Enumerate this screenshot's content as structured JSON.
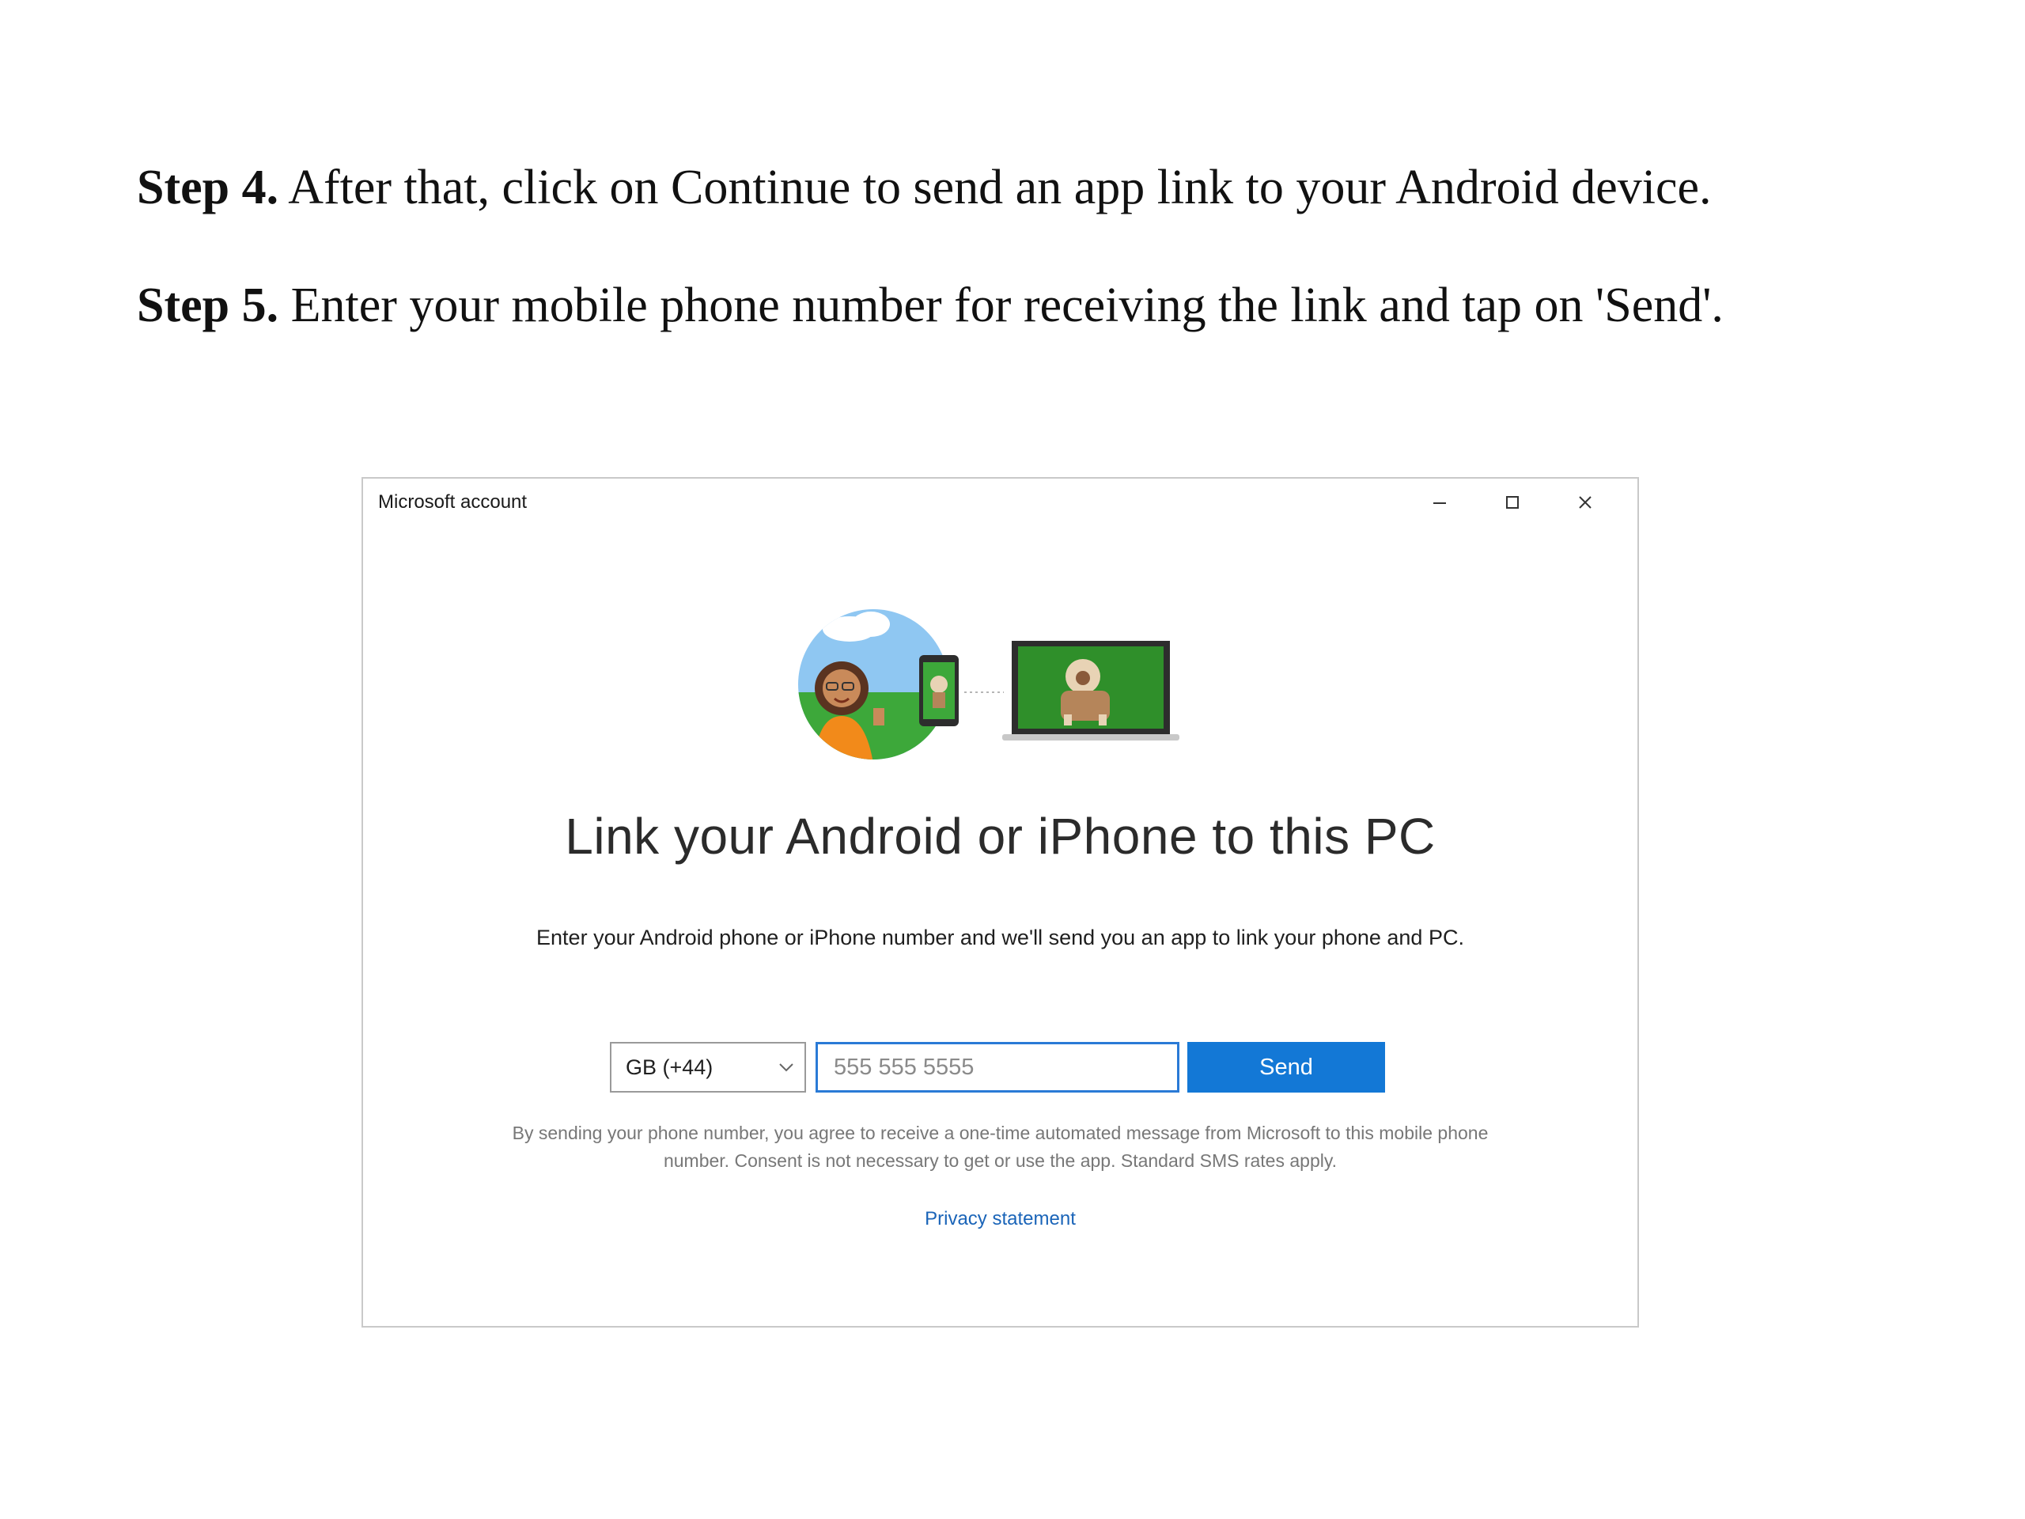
{
  "instructions": {
    "step4": {
      "label": "Step 4.",
      "text": " After that, click on Continue to send an app link to your Android device."
    },
    "step5": {
      "label": "Step 5.",
      "text": " Enter your mobile phone number for receiving the link and tap on 'Send'."
    }
  },
  "window": {
    "title": "Microsoft account",
    "controls": [
      "minimize-icon",
      "maximize-icon",
      "close-icon"
    ]
  },
  "dialog": {
    "heading": "Link your Android or iPhone to this PC",
    "description": "Enter your Android phone or iPhone number and we'll send you an app to link your phone and PC.",
    "country_select": {
      "value": "GB (+44)"
    },
    "phone_input": {
      "value": "",
      "placeholder": "555 555 5555"
    },
    "send_label": "Send",
    "disclaimer": "By sending your phone number, you agree to receive a one-time automated message from Microsoft to this mobile phone number. Consent is not necessary to get or use the app. Standard SMS rates apply.",
    "privacy_link": "Privacy statement"
  },
  "colors": {
    "accent": "#1378d6",
    "input_focus_border": "#2a7ad6",
    "link": "#1a64b8"
  }
}
